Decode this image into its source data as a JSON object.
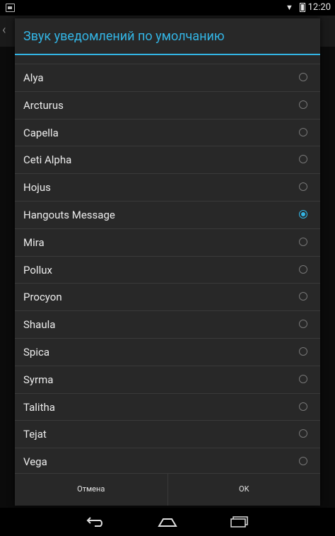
{
  "statusbar": {
    "time": "12:20"
  },
  "dialog": {
    "title": "Звук уведомлений по умолчанию",
    "items": [
      {
        "label": "Alya",
        "checked": false
      },
      {
        "label": "Arcturus",
        "checked": false
      },
      {
        "label": "Capella",
        "checked": false
      },
      {
        "label": "Ceti Alpha",
        "checked": false
      },
      {
        "label": "Hojus",
        "checked": false
      },
      {
        "label": "Hangouts Message",
        "checked": true
      },
      {
        "label": "Mira",
        "checked": false
      },
      {
        "label": "Pollux",
        "checked": false
      },
      {
        "label": "Procyon",
        "checked": false
      },
      {
        "label": "Shaula",
        "checked": false
      },
      {
        "label": "Spica",
        "checked": false
      },
      {
        "label": "Syrma",
        "checked": false
      },
      {
        "label": "Talitha",
        "checked": false
      },
      {
        "label": "Tejat",
        "checked": false
      },
      {
        "label": "Vega",
        "checked": false
      }
    ],
    "cancel_label": "Отмена",
    "ok_label": "OK"
  },
  "colors": {
    "accent": "#33b5e5",
    "dialog_bg": "#282828"
  },
  "icons": {
    "back": "back-icon",
    "home": "home-icon",
    "recents": "recents-icon"
  }
}
